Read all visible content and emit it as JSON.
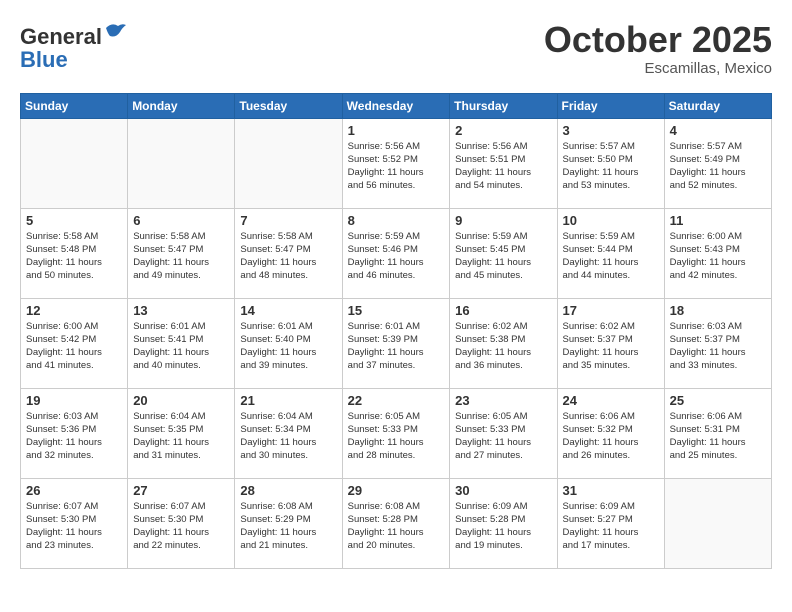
{
  "header": {
    "logo_line1": "General",
    "logo_line2": "Blue",
    "month": "October 2025",
    "location": "Escamillas, Mexico"
  },
  "weekdays": [
    "Sunday",
    "Monday",
    "Tuesday",
    "Wednesday",
    "Thursday",
    "Friday",
    "Saturday"
  ],
  "weeks": [
    [
      {
        "day": "",
        "info": ""
      },
      {
        "day": "",
        "info": ""
      },
      {
        "day": "",
        "info": ""
      },
      {
        "day": "1",
        "info": "Sunrise: 5:56 AM\nSunset: 5:52 PM\nDaylight: 11 hours\nand 56 minutes."
      },
      {
        "day": "2",
        "info": "Sunrise: 5:56 AM\nSunset: 5:51 PM\nDaylight: 11 hours\nand 54 minutes."
      },
      {
        "day": "3",
        "info": "Sunrise: 5:57 AM\nSunset: 5:50 PM\nDaylight: 11 hours\nand 53 minutes."
      },
      {
        "day": "4",
        "info": "Sunrise: 5:57 AM\nSunset: 5:49 PM\nDaylight: 11 hours\nand 52 minutes."
      }
    ],
    [
      {
        "day": "5",
        "info": "Sunrise: 5:58 AM\nSunset: 5:48 PM\nDaylight: 11 hours\nand 50 minutes."
      },
      {
        "day": "6",
        "info": "Sunrise: 5:58 AM\nSunset: 5:47 PM\nDaylight: 11 hours\nand 49 minutes."
      },
      {
        "day": "7",
        "info": "Sunrise: 5:58 AM\nSunset: 5:47 PM\nDaylight: 11 hours\nand 48 minutes."
      },
      {
        "day": "8",
        "info": "Sunrise: 5:59 AM\nSunset: 5:46 PM\nDaylight: 11 hours\nand 46 minutes."
      },
      {
        "day": "9",
        "info": "Sunrise: 5:59 AM\nSunset: 5:45 PM\nDaylight: 11 hours\nand 45 minutes."
      },
      {
        "day": "10",
        "info": "Sunrise: 5:59 AM\nSunset: 5:44 PM\nDaylight: 11 hours\nand 44 minutes."
      },
      {
        "day": "11",
        "info": "Sunrise: 6:00 AM\nSunset: 5:43 PM\nDaylight: 11 hours\nand 42 minutes."
      }
    ],
    [
      {
        "day": "12",
        "info": "Sunrise: 6:00 AM\nSunset: 5:42 PM\nDaylight: 11 hours\nand 41 minutes."
      },
      {
        "day": "13",
        "info": "Sunrise: 6:01 AM\nSunset: 5:41 PM\nDaylight: 11 hours\nand 40 minutes."
      },
      {
        "day": "14",
        "info": "Sunrise: 6:01 AM\nSunset: 5:40 PM\nDaylight: 11 hours\nand 39 minutes."
      },
      {
        "day": "15",
        "info": "Sunrise: 6:01 AM\nSunset: 5:39 PM\nDaylight: 11 hours\nand 37 minutes."
      },
      {
        "day": "16",
        "info": "Sunrise: 6:02 AM\nSunset: 5:38 PM\nDaylight: 11 hours\nand 36 minutes."
      },
      {
        "day": "17",
        "info": "Sunrise: 6:02 AM\nSunset: 5:37 PM\nDaylight: 11 hours\nand 35 minutes."
      },
      {
        "day": "18",
        "info": "Sunrise: 6:03 AM\nSunset: 5:37 PM\nDaylight: 11 hours\nand 33 minutes."
      }
    ],
    [
      {
        "day": "19",
        "info": "Sunrise: 6:03 AM\nSunset: 5:36 PM\nDaylight: 11 hours\nand 32 minutes."
      },
      {
        "day": "20",
        "info": "Sunrise: 6:04 AM\nSunset: 5:35 PM\nDaylight: 11 hours\nand 31 minutes."
      },
      {
        "day": "21",
        "info": "Sunrise: 6:04 AM\nSunset: 5:34 PM\nDaylight: 11 hours\nand 30 minutes."
      },
      {
        "day": "22",
        "info": "Sunrise: 6:05 AM\nSunset: 5:33 PM\nDaylight: 11 hours\nand 28 minutes."
      },
      {
        "day": "23",
        "info": "Sunrise: 6:05 AM\nSunset: 5:33 PM\nDaylight: 11 hours\nand 27 minutes."
      },
      {
        "day": "24",
        "info": "Sunrise: 6:06 AM\nSunset: 5:32 PM\nDaylight: 11 hours\nand 26 minutes."
      },
      {
        "day": "25",
        "info": "Sunrise: 6:06 AM\nSunset: 5:31 PM\nDaylight: 11 hours\nand 25 minutes."
      }
    ],
    [
      {
        "day": "26",
        "info": "Sunrise: 6:07 AM\nSunset: 5:30 PM\nDaylight: 11 hours\nand 23 minutes."
      },
      {
        "day": "27",
        "info": "Sunrise: 6:07 AM\nSunset: 5:30 PM\nDaylight: 11 hours\nand 22 minutes."
      },
      {
        "day": "28",
        "info": "Sunrise: 6:08 AM\nSunset: 5:29 PM\nDaylight: 11 hours\nand 21 minutes."
      },
      {
        "day": "29",
        "info": "Sunrise: 6:08 AM\nSunset: 5:28 PM\nDaylight: 11 hours\nand 20 minutes."
      },
      {
        "day": "30",
        "info": "Sunrise: 6:09 AM\nSunset: 5:28 PM\nDaylight: 11 hours\nand 19 minutes."
      },
      {
        "day": "31",
        "info": "Sunrise: 6:09 AM\nSunset: 5:27 PM\nDaylight: 11 hours\nand 17 minutes."
      },
      {
        "day": "",
        "info": ""
      }
    ]
  ]
}
